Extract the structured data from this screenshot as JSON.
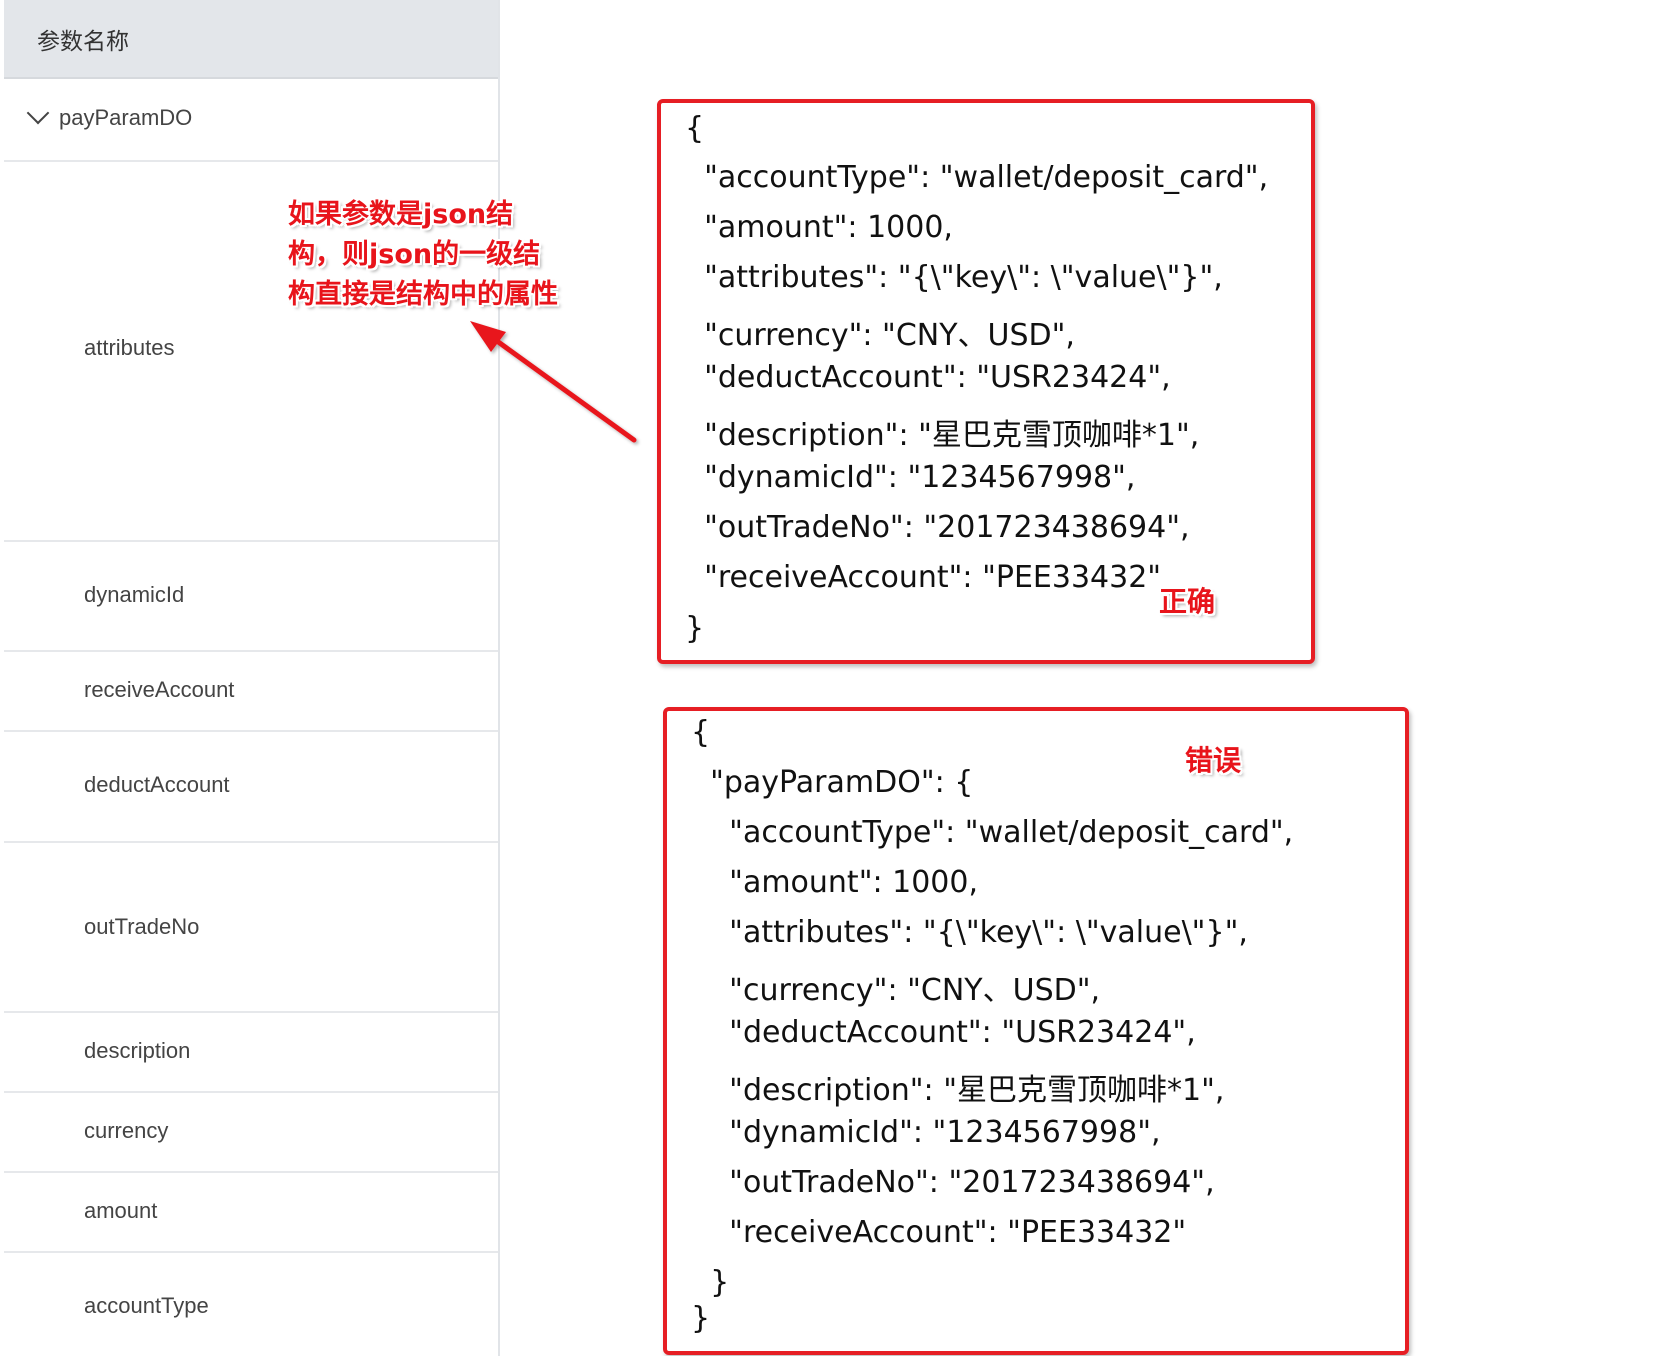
{
  "param_table": {
    "header": "参数名称",
    "group": {
      "label": "payParamDO",
      "expanded": true
    },
    "rows": [
      {
        "label": "attributes"
      },
      {
        "label": "dynamicId"
      },
      {
        "label": "receiveAccount"
      },
      {
        "label": "deductAccount"
      },
      {
        "label": "outTradeNo"
      },
      {
        "label": "description"
      },
      {
        "label": "currency"
      },
      {
        "label": "amount"
      },
      {
        "label": "accountType"
      }
    ]
  },
  "annotation": {
    "lines": [
      "如果参数是json结",
      "构，则json的一级结",
      "构直接是结构中的属性"
    ],
    "color": "#e8141b"
  },
  "correct_example": {
    "label": "正确",
    "lines": [
      "{",
      "  \"accountType\": \"wallet/deposit_card\",",
      "  \"amount\": 1000,",
      "  \"attributes\": \"{\\\"key\\\": \\\"value\\\"}\",",
      "  \"currency\": \"CNY、USD\",",
      "  \"deductAccount\": \"USR23424\",",
      "  \"description\": \"星巴克雪顶咖啡*1\",",
      "  \"dynamicId\": \"1234567998\",",
      "  \"outTradeNo\": \"201723438694\",",
      "  \"receiveAccount\": \"PEE33432\"",
      "}"
    ]
  },
  "wrong_example": {
    "label": "错误",
    "lines": [
      "{",
      "  \"payParamDO\": {",
      "    \"accountType\": \"wallet/deposit_card\",",
      "    \"amount\": 1000,",
      "    \"attributes\": \"{\\\"key\\\": \\\"value\\\"}\",",
      "    \"currency\": \"CNY、USD\",",
      "    \"deductAccount\": \"USR23424\",",
      "    \"description\": \"星巴克雪顶咖啡*1\",",
      "    \"dynamicId\": \"1234567998\",",
      "    \"outTradeNo\": \"201723438694\",",
      "    \"receiveAccount\": \"PEE33432\"",
      "  }",
      "}"
    ]
  },
  "colors": {
    "box_border": "#e61e24",
    "header_bg": "#e3e6ea"
  }
}
